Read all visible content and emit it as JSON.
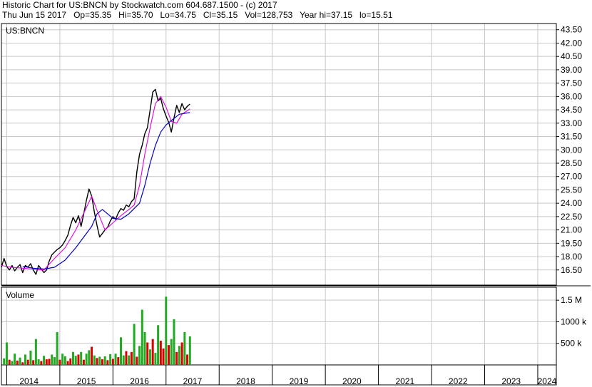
{
  "header": {
    "line1": "Historic Chart for US:BNCN by Stockwatch.com 604.687.1500 - (c) 2017",
    "line2": "Thu Jun 15 2017   Op=35.35   Hi=35.70   Lo=34.75   Cl=35.15   Vol=128,753   Year hi=37.15   lo=15.51"
  },
  "colors": {
    "price": "#000000",
    "ma_short": "#e000e0",
    "ma_long": "#0000c8",
    "vol_up": "#22aa22",
    "vol_down": "#dd0000",
    "grid": "#c8c8c8"
  },
  "chart_data": {
    "type": "line",
    "symbol_label": "US:BNCN",
    "volume_label": "Volume",
    "x_tick_labels": [
      "2014",
      "2015",
      "2016",
      "2017",
      "2018",
      "2019",
      "2020",
      "2021",
      "2022",
      "2023",
      "2024"
    ],
    "xlim": [
      2013.9,
      2024.35
    ],
    "price": {
      "ylim": [
        14.8,
        44.2
      ],
      "tick_labels": [
        "43.50",
        "42.00",
        "40.50",
        "39.00",
        "37.50",
        "36.00",
        "34.50",
        "33.00",
        "31.50",
        "30.00",
        "28.50",
        "27.00",
        "25.50",
        "24.00",
        "22.50",
        "21.00",
        "19.50",
        "18.00",
        "16.50"
      ],
      "tick_values": [
        43.5,
        42,
        40.5,
        39,
        37.5,
        36,
        34.5,
        33,
        31.5,
        30,
        28.5,
        27,
        25.5,
        24,
        22.5,
        21,
        19.5,
        18,
        16.5
      ],
      "series": [
        {
          "role": "close",
          "x": [
            2013.9,
            2013.95,
            2014.0,
            2014.05,
            2014.1,
            2014.15,
            2014.2,
            2014.25,
            2014.3,
            2014.35,
            2014.4,
            2014.45,
            2014.5,
            2014.55,
            2014.6,
            2014.65,
            2014.7,
            2014.75,
            2014.8,
            2014.85,
            2014.9,
            2014.95,
            2015.0,
            2015.05,
            2015.1,
            2015.15,
            2015.2,
            2015.25,
            2015.3,
            2015.35,
            2015.4,
            2015.45,
            2015.5,
            2015.55,
            2015.6,
            2015.65,
            2015.7,
            2015.75,
            2015.8,
            2015.85,
            2015.9,
            2015.95,
            2016.0,
            2016.05,
            2016.1,
            2016.15,
            2016.2,
            2016.25,
            2016.3,
            2016.35,
            2016.4,
            2016.45,
            2016.5,
            2016.55,
            2016.6,
            2016.65,
            2016.7,
            2016.75,
            2016.8,
            2016.85,
            2016.9,
            2016.95,
            2017.0,
            2017.05,
            2017.1,
            2017.15,
            2017.2,
            2017.25,
            2017.3,
            2017.35,
            2017.4,
            2017.45
          ],
          "y": [
            16.8,
            17.8,
            16.9,
            16.5,
            17.0,
            16.4,
            16.8,
            17.1,
            16.2,
            17.0,
            16.8,
            17.2,
            16.5,
            16.0,
            17.0,
            16.6,
            16.2,
            16.5,
            17.5,
            18.2,
            18.5,
            18.8,
            19.0,
            19.3,
            19.8,
            20.4,
            21.5,
            22.4,
            21.8,
            22.6,
            21.4,
            22.8,
            24.3,
            25.6,
            24.8,
            23.0,
            21.5,
            20.2,
            20.6,
            21.0,
            21.3,
            22.0,
            22.5,
            22.2,
            22.9,
            23.4,
            23.2,
            23.8,
            23.6,
            24.2,
            24.5,
            27.5,
            29.5,
            30.5,
            31.8,
            32.5,
            34.5,
            36.5,
            36.8,
            35.5,
            35.8,
            34.6,
            33.8,
            33.1,
            32.0,
            33.6,
            35.0,
            34.2,
            35.2,
            34.5,
            34.9,
            35.15
          ]
        },
        {
          "role": "ma_short",
          "x": [
            2013.9,
            2014.1,
            2014.3,
            2014.5,
            2014.7,
            2014.9,
            2015.1,
            2015.3,
            2015.5,
            2015.6,
            2015.7,
            2015.85,
            2016.0,
            2016.15,
            2016.3,
            2016.4,
            2016.5,
            2016.6,
            2016.7,
            2016.8,
            2016.9,
            2017.0,
            2017.1,
            2017.2,
            2017.3,
            2017.45
          ],
          "y": [
            17.0,
            16.8,
            16.7,
            16.6,
            16.5,
            17.8,
            19.0,
            21.0,
            23.5,
            24.8,
            23.2,
            21.0,
            21.8,
            22.6,
            23.3,
            23.8,
            26.0,
            29.5,
            32.5,
            35.2,
            36.0,
            34.8,
            33.2,
            33.0,
            34.0,
            34.6
          ]
        },
        {
          "role": "ma_long",
          "x": [
            2014.3,
            2014.5,
            2014.7,
            2014.9,
            2015.1,
            2015.3,
            2015.45,
            2015.6,
            2015.7,
            2015.8,
            2015.9,
            2016.0,
            2016.15,
            2016.3,
            2016.4,
            2016.5,
            2016.6,
            2016.7,
            2016.8,
            2016.9,
            2017.0,
            2017.1,
            2017.25,
            2017.45
          ],
          "y": [
            16.9,
            16.7,
            16.6,
            16.8,
            17.6,
            19.0,
            20.2,
            21.4,
            22.8,
            23.3,
            22.8,
            22.3,
            22.2,
            22.8,
            23.4,
            24.0,
            26.0,
            28.5,
            30.5,
            32.0,
            32.8,
            33.3,
            34.0,
            34.2
          ]
        }
      ]
    },
    "volume": {
      "ylim": [
        0,
        1800000
      ],
      "tick_labels": [
        "1.5 M",
        "1000 k",
        "500 k"
      ],
      "tick_values": [
        1500000,
        1000000,
        500000
      ],
      "x": [
        2013.95,
        2014.0,
        2014.05,
        2014.1,
        2014.15,
        2014.2,
        2014.25,
        2014.3,
        2014.35,
        2014.4,
        2014.45,
        2014.5,
        2014.55,
        2014.6,
        2014.65,
        2014.7,
        2014.75,
        2014.8,
        2014.85,
        2014.9,
        2014.95,
        2015.0,
        2015.05,
        2015.1,
        2015.15,
        2015.2,
        2015.25,
        2015.3,
        2015.35,
        2015.4,
        2015.45,
        2015.5,
        2015.55,
        2015.6,
        2015.65,
        2015.7,
        2015.75,
        2015.8,
        2015.85,
        2015.9,
        2015.95,
        2016.0,
        2016.05,
        2016.1,
        2016.15,
        2016.2,
        2016.25,
        2016.3,
        2016.35,
        2016.4,
        2016.45,
        2016.5,
        2016.55,
        2016.6,
        2016.65,
        2016.7,
        2016.75,
        2016.8,
        2016.85,
        2016.9,
        2016.95,
        2017.0,
        2017.05,
        2017.1,
        2017.15,
        2017.2,
        2017.25,
        2017.3,
        2017.35,
        2017.4,
        2017.45
      ],
      "values": [
        150000,
        520000,
        120000,
        90000,
        260000,
        100000,
        170000,
        60000,
        240000,
        120000,
        330000,
        110000,
        600000,
        130000,
        90000,
        210000,
        130000,
        140000,
        240000,
        180000,
        760000,
        120000,
        260000,
        200000,
        90000,
        150000,
        300000,
        210000,
        240000,
        300000,
        120000,
        260000,
        340000,
        420000,
        220000,
        160000,
        190000,
        130000,
        200000,
        110000,
        250000,
        140000,
        260000,
        180000,
        640000,
        220000,
        320000,
        220000,
        300000,
        950000,
        190000,
        440000,
        1280000,
        760000,
        520000,
        360000,
        600000,
        280000,
        920000,
        560000,
        380000,
        1580000,
        460000,
        600000,
        1060000,
        300000,
        440000,
        520000,
        760000,
        240000,
        660000
      ],
      "up": [
        true,
        true,
        false,
        true,
        true,
        false,
        true,
        false,
        true,
        false,
        true,
        false,
        true,
        true,
        false,
        true,
        false,
        false,
        true,
        true,
        true,
        false,
        true,
        true,
        false,
        false,
        true,
        true,
        false,
        true,
        false,
        true,
        true,
        false,
        true,
        false,
        true,
        false,
        true,
        false,
        true,
        false,
        true,
        false,
        true,
        true,
        false,
        true,
        false,
        true,
        false,
        true,
        true,
        true,
        false,
        true,
        false,
        true,
        true,
        false,
        false,
        true,
        false,
        true,
        true,
        false,
        true,
        false,
        true,
        false,
        true
      ]
    }
  }
}
